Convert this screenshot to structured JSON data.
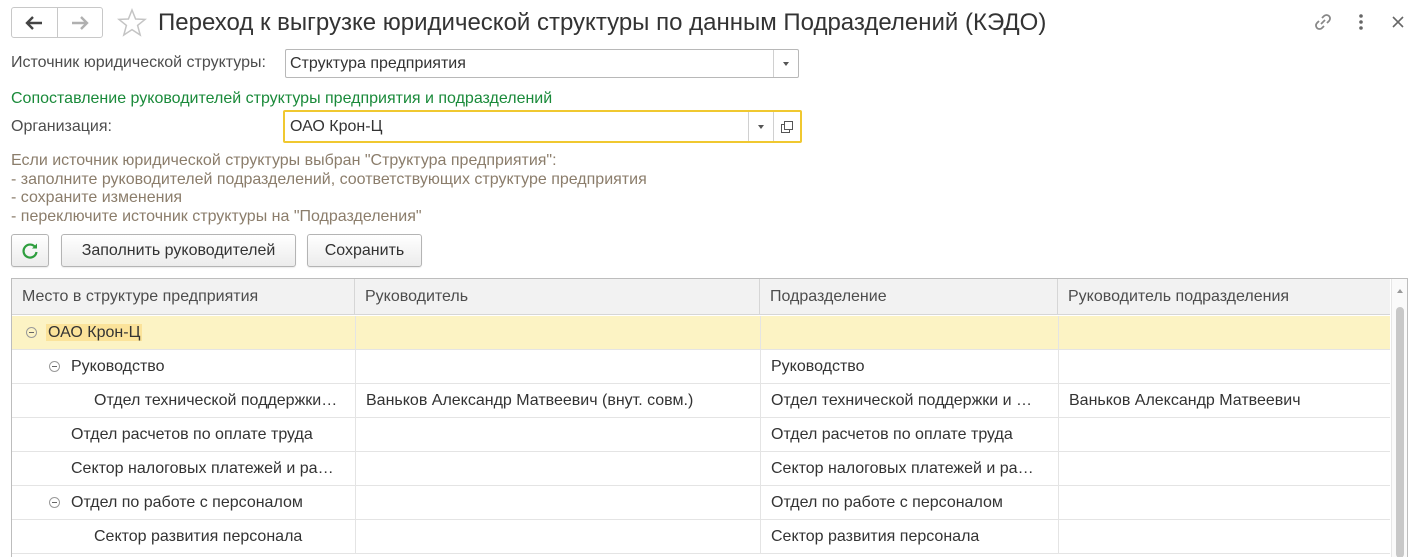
{
  "header": {
    "title": "Переход к выгрузке юридической структуры по данным Подразделений (КЭДО)"
  },
  "form": {
    "source_label": "Источник юридической структуры:",
    "source_value": "Структура предприятия",
    "section_title": "Сопоставление руководителей структуры предприятия и подразделений",
    "org_label": "Организация:",
    "org_value": "ОАО Крон-Ц"
  },
  "info": {
    "line1": "Если источник юридической структуры выбран \"Структура предприятия\":",
    "line2": "- заполните руководителей подразделений, соответствующих структуре предприятия",
    "line3": "- сохраните изменения",
    "line4": "- переключите источник структуры на \"Подразделения\""
  },
  "toolbar": {
    "fill_label": "Заполнить руководителей",
    "save_label": "Сохранить"
  },
  "table": {
    "columns": [
      "Место в структуре предприятия",
      "Руководитель",
      "Подразделение",
      "Руководитель подразделения"
    ],
    "rows": [
      {
        "place": "ОАО Крон-Ц",
        "manager": "",
        "division": "",
        "division_manager": ""
      },
      {
        "place": "Руководство",
        "manager": "",
        "division": "Руководство",
        "division_manager": ""
      },
      {
        "place": "Отдел технической поддержки…",
        "manager": "Ваньков Александр Матвеевич (внут. совм.)",
        "division": "Отдел технической поддержки и …",
        "division_manager": "Ваньков Александр Матвеевич"
      },
      {
        "place": "Отдел расчетов по оплате труда",
        "manager": "",
        "division": "Отдел расчетов по оплате труда",
        "division_manager": ""
      },
      {
        "place": "Сектор налоговых платежей и ра…",
        "manager": "",
        "division": "Сектор налоговых платежей и ра…",
        "division_manager": ""
      },
      {
        "place": "Отдел по работе с персоналом",
        "manager": "",
        "division": "Отдел по работе с персоналом",
        "division_manager": ""
      },
      {
        "place": "Сектор развития персонала",
        "manager": "",
        "division": "Сектор развития персонала",
        "division_manager": ""
      }
    ]
  },
  "colors": {
    "section_title": "#1a8a3a",
    "info_text": "#8b7d6b",
    "focus_border": "#f0c830",
    "selected_row": "#fcf3c4",
    "refresh_icon": "#2e9e3e"
  }
}
